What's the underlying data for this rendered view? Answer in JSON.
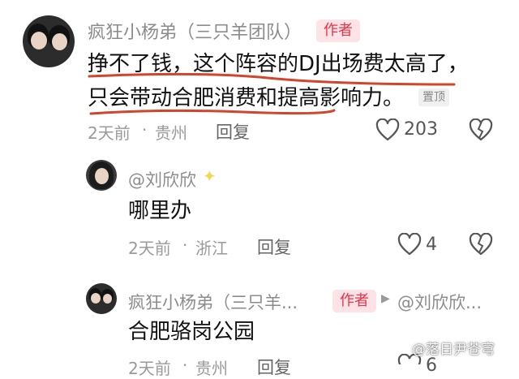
{
  "comment": {
    "username": "疯狂小杨弟（三只羊团队）",
    "author_badge": "作者",
    "text_line1": "挣不了钱，这个阵容的DJ出场费太高了，",
    "text_line2": "只会带动合肥消费和提高影响力。",
    "pinned_label": "置顶",
    "time": "2天前",
    "location": "贵州",
    "reply_label": "回复",
    "like_count": "203"
  },
  "reply1": {
    "username": "@刘欣欣",
    "text": "哪里办",
    "time": "2天前",
    "location": "浙江",
    "reply_label": "回复",
    "like_count": "4"
  },
  "reply2": {
    "username": "疯狂小杨弟（三只羊...",
    "author_badge": "作者",
    "reply_to": "@刘欣欣...",
    "text": "合肥骆岗公园",
    "time": "2天前",
    "location": "贵州",
    "reply_label": "回复",
    "like_count": "6"
  },
  "watermark": "@落日尹苍穹",
  "colors": {
    "underline": "#d2452a",
    "author": "#e8334a"
  }
}
